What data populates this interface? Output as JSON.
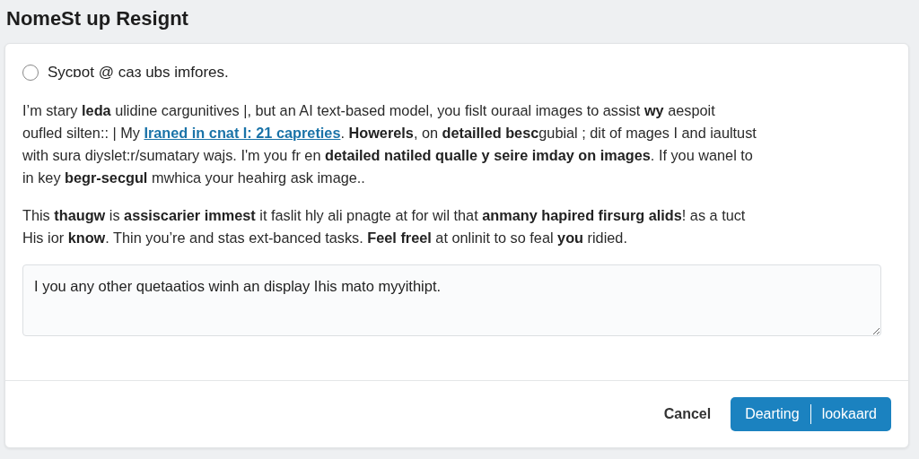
{
  "title": "NomeSt up Resignt",
  "option": {
    "label": "Sycɒot @ caɜ ubs imfores.",
    "selected": false
  },
  "paragraphs": [
    [
      {
        "kind": "text",
        "text": "I’m stary **leda** ulidine cargunitives |, but an AI text-based model, you fislt ouraal images to assist **wy** aespoit\noufled silten:: | My "
      },
      {
        "kind": "link",
        "text": "Iraned in cnat I: 21 capreties"
      },
      {
        "kind": "text",
        "text": ". **Howerels**, on **detailled besc**gubial ; dit of mages I and iaultust\nwith sura diyslet:r/sumatary wajs. I'm you fr en **detailed natiled qualle y seire imday on images**. If you wanel to\nin key **begr-secgul** mwhica your heahirg ask image.."
      }
    ],
    [
      {
        "kind": "text",
        "text": "This **thaugw** is **assiscarier immest** it faslit hly ali pnagte at for wil that **anmany hapired firsurg alids**! as a tuct\nHis ior **know**. Thin you’re and stas ext-banced tasks. **Feel freel** at onlinit to so feal **you** ridied."
      }
    ]
  ],
  "textarea": {
    "value": "I you any other quetaatios winh an display Ihis mato myyithipt."
  },
  "buttons": [
    {
      "kind": "plain",
      "labels": [
        "Cancel"
      ]
    },
    {
      "kind": "primary",
      "labels": [
        "Dearting",
        "lookaard"
      ]
    }
  ]
}
